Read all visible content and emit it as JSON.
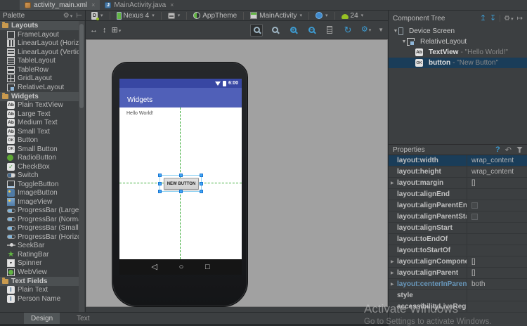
{
  "tabs": [
    {
      "label": "activity_main.xml"
    },
    {
      "label": "MainActivity.java"
    }
  ],
  "palette": {
    "title": "Palette",
    "sections": [
      {
        "label": "Layouts",
        "items": [
          {
            "label": "FrameLayout",
            "icon": "frame"
          },
          {
            "label": "LinearLayout (Horizontal)",
            "icon": "lin-h"
          },
          {
            "label": "LinearLayout (Vertical)",
            "icon": "lin-v"
          },
          {
            "label": "TableLayout",
            "icon": "table"
          },
          {
            "label": "TableRow",
            "icon": "row"
          },
          {
            "label": "GridLayout",
            "icon": "grid"
          },
          {
            "label": "RelativeLayout",
            "icon": "rel"
          }
        ]
      },
      {
        "label": "Widgets",
        "items": [
          {
            "label": "Plain TextView",
            "icon": "ab"
          },
          {
            "label": "Large Text",
            "icon": "ab"
          },
          {
            "label": "Medium Text",
            "icon": "ab"
          },
          {
            "label": "Small Text",
            "icon": "ab"
          },
          {
            "label": "Button",
            "icon": "ok"
          },
          {
            "label": "Small Button",
            "icon": "ok"
          },
          {
            "label": "RadioButton",
            "icon": "radio"
          },
          {
            "label": "CheckBox",
            "icon": "check"
          },
          {
            "label": "Switch",
            "icon": "switch"
          },
          {
            "label": "ToggleButton",
            "icon": "toggle"
          },
          {
            "label": "ImageButton",
            "icon": "imgbtn"
          },
          {
            "label": "ImageView",
            "icon": "imgview"
          },
          {
            "label": "ProgressBar (Large)",
            "icon": "progress"
          },
          {
            "label": "ProgressBar (Normal)",
            "icon": "progress"
          },
          {
            "label": "ProgressBar (Small)",
            "icon": "progress"
          },
          {
            "label": "ProgressBar (Horizontal)",
            "icon": "progress"
          },
          {
            "label": "SeekBar",
            "icon": "seek"
          },
          {
            "label": "RatingBar",
            "icon": "rating"
          },
          {
            "label": "Spinner",
            "icon": "spinner"
          },
          {
            "label": "WebView",
            "icon": "web"
          }
        ]
      },
      {
        "label": "Text Fields",
        "items": [
          {
            "label": "Plain Text",
            "icon": "textfield"
          },
          {
            "label": "Person Name",
            "icon": "textfield"
          }
        ]
      }
    ]
  },
  "toolbar": {
    "device": "Nexus 4",
    "theme": "AppTheme",
    "activity": "MainActivity",
    "api": "24"
  },
  "phone": {
    "status_time": "6:00",
    "app_title": "Widgets",
    "hello_text": "Hello World!",
    "button_label": "NEW BUTTON",
    "nav": {
      "back": "◁",
      "home": "○",
      "recents": "□"
    }
  },
  "component_tree": {
    "title": "Component Tree",
    "nodes": [
      {
        "label": "Device Screen",
        "icon": "phone",
        "depth": 0,
        "expander": true,
        "selected": false,
        "suffix": ""
      },
      {
        "label": "RelativeLayout",
        "icon": "rel",
        "depth": 1,
        "expander": true,
        "selected": false,
        "suffix": ""
      },
      {
        "label": "TextView",
        "suffix": "- \"Hello World!\"",
        "icon": "ab",
        "depth": 2,
        "expander": false,
        "selected": false
      },
      {
        "label": "button",
        "suffix": "- \"New Button\"",
        "icon": "ok",
        "depth": 2,
        "expander": false,
        "selected": true
      }
    ]
  },
  "properties": {
    "title": "Properties",
    "rows": [
      {
        "name": "layout:width",
        "value": "wrap_content",
        "selected": true,
        "expandable": false,
        "checkbox": false,
        "blue": false
      },
      {
        "name": "layout:height",
        "value": "wrap_content",
        "selected": false,
        "expandable": false,
        "checkbox": false,
        "blue": false
      },
      {
        "name": "layout:margin",
        "value": "[]",
        "selected": false,
        "expandable": true,
        "checkbox": false,
        "blue": false
      },
      {
        "name": "layout:alignEnd",
        "value": "",
        "selected": false,
        "expandable": false,
        "checkbox": false,
        "blue": false
      },
      {
        "name": "layout:alignParentEnd",
        "value": "",
        "selected": false,
        "expandable": false,
        "checkbox": true,
        "blue": false
      },
      {
        "name": "layout:alignParentStart",
        "value": "",
        "selected": false,
        "expandable": false,
        "checkbox": true,
        "blue": false
      },
      {
        "name": "layout:alignStart",
        "value": "",
        "selected": false,
        "expandable": false,
        "checkbox": false,
        "blue": false
      },
      {
        "name": "layout:toEndOf",
        "value": "",
        "selected": false,
        "expandable": false,
        "checkbox": false,
        "blue": false
      },
      {
        "name": "layout:toStartOf",
        "value": "",
        "selected": false,
        "expandable": false,
        "checkbox": false,
        "blue": false
      },
      {
        "name": "layout:alignComponent",
        "value": "[]",
        "selected": false,
        "expandable": true,
        "checkbox": false,
        "blue": false
      },
      {
        "name": "layout:alignParent",
        "value": "[]",
        "selected": false,
        "expandable": true,
        "checkbox": false,
        "blue": false
      },
      {
        "name": "layout:centerInParent",
        "value": "both",
        "selected": false,
        "expandable": true,
        "checkbox": false,
        "blue": true
      },
      {
        "name": "style",
        "value": "",
        "selected": false,
        "expandable": false,
        "checkbox": false,
        "blue": false
      },
      {
        "name": "accessibilityLiveRegion",
        "value": "",
        "selected": false,
        "expandable": false,
        "checkbox": false,
        "blue": false
      }
    ]
  },
  "bottom_tabs": [
    {
      "label": "Design",
      "selected": true
    },
    {
      "label": "Text",
      "selected": false
    }
  ],
  "watermark": {
    "line1": "Activate Windows",
    "line2": "Go to Settings to activate Windows."
  }
}
